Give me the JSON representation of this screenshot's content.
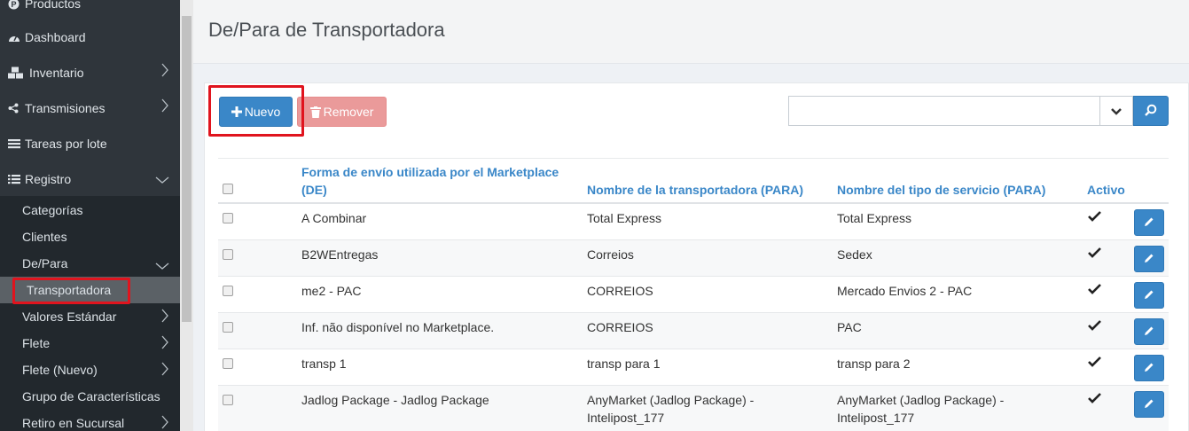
{
  "sidebar": {
    "items": [
      {
        "label": "Productos",
        "icon": "productos-icon"
      },
      {
        "label": "Dashboard",
        "icon": "dashboard-icon"
      },
      {
        "label": "Inventario",
        "icon": "cubes-icon"
      },
      {
        "label": "Transmisiones",
        "icon": "share-icon"
      },
      {
        "label": "Tareas por lote",
        "icon": "list-icon"
      },
      {
        "label": "Registro",
        "icon": "list-ul-icon"
      }
    ],
    "submenu": [
      {
        "label": "Categorías"
      },
      {
        "label": "Clientes"
      },
      {
        "label": "De/Para"
      },
      {
        "label": "Transportadora"
      },
      {
        "label": "Valores Estándar"
      },
      {
        "label": "Flete"
      },
      {
        "label": "Flete (Nuevo)"
      },
      {
        "label": "Grupo de Características"
      },
      {
        "label": "Retiro en Sucursal"
      }
    ]
  },
  "header": {
    "title": "De/Para de Transportadora"
  },
  "toolbar": {
    "new_label": "Nuevo",
    "remove_label": "Remover",
    "search_value": ""
  },
  "table": {
    "columns": [
      "Forma de envío utilizada por el Marketplace (DE)",
      "Nombre de la transportadora (PARA)",
      "Nombre del tipo de servicio (PARA)",
      "Activo"
    ],
    "rows": [
      {
        "de": "A Combinar",
        "transportadora": "Total Express",
        "servicio": "Total Express"
      },
      {
        "de": "B2WEntregas",
        "transportadora": "Correios",
        "servicio": "Sedex"
      },
      {
        "de": "me2 - PAC",
        "transportadora": "CORREIOS",
        "servicio": "Mercado Envios 2 - PAC"
      },
      {
        "de": "Inf. não disponível no Marketplace.",
        "transportadora": "CORREIOS",
        "servicio": "PAC"
      },
      {
        "de": "transp 1",
        "transportadora": "transp para 1",
        "servicio": "transp para 2"
      },
      {
        "de": "Jadlog Package - Jadlog Package",
        "transportadora": "AnyMarket (Jadlog Package) - Intelipost_177",
        "servicio": "AnyMarket (Jadlog Package) - Intelipost_177"
      }
    ]
  },
  "colors": {
    "accent": "#3a87c8",
    "danger": "#ea9a9a",
    "sidebar": "#2f353b",
    "highlight": "#e0141e"
  }
}
